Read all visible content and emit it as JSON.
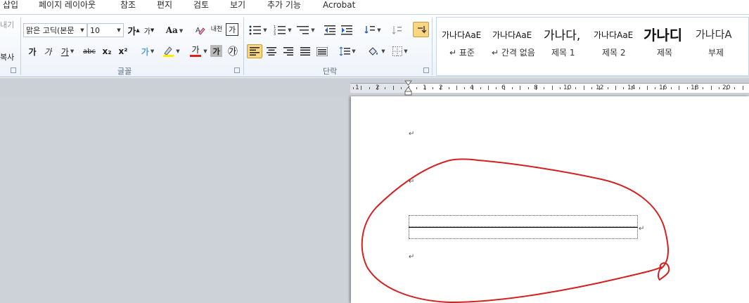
{
  "menu": {
    "tabs": [
      "삽입",
      "페이지 레이아웃",
      "참조",
      "편지",
      "검토",
      "보기",
      "추가 기능",
      "Acrobat"
    ]
  },
  "clipboard": {
    "partial_top": "내기",
    "partial_copy": "복사"
  },
  "font_group": {
    "label": "글꼴",
    "font_name": "맑은 고딕(본문",
    "font_size": "10",
    "grow_label": "가",
    "shrink_label": "가",
    "case_label": "Aa",
    "phonetic_label": "내천",
    "border_label": "가",
    "bold": "가",
    "italic": "가",
    "underline": "가",
    "strike": "abc",
    "subscript": "x₂",
    "superscript": "x²",
    "effects": "가",
    "font_color_label": "가",
    "shading_label": "가",
    "enclose_label": "㉮"
  },
  "paragraph_group": {
    "label": "단락"
  },
  "styles_gallery": {
    "items": [
      {
        "sample": "가나다AaE",
        "name": "↵ 표준"
      },
      {
        "sample": "가나다AaE",
        "name": "↵ 간격 없음"
      },
      {
        "sample": "가나다,",
        "name": "제목 1"
      },
      {
        "sample": "가나다AaE",
        "name": "제목 2"
      },
      {
        "sample": "가나디",
        "name": "제목"
      },
      {
        "sample": "가나다A",
        "name": "부제"
      }
    ]
  },
  "ruler": {
    "numbers": [
      "1",
      "2",
      "1",
      "2",
      "4",
      "6",
      "8",
      "10",
      "12",
      "14",
      "16",
      "18",
      "20"
    ]
  },
  "document": {
    "paragraph_mark": "↵"
  },
  "colors": {
    "annotation_red": "#d42020",
    "highlight_yellow": "#ffee00",
    "font_red": "#e0201a"
  }
}
